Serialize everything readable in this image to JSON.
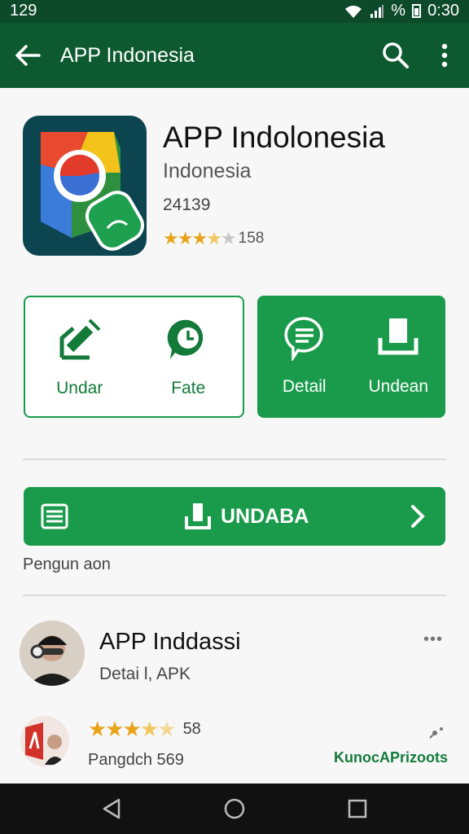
{
  "status_bar": {
    "time_left": "129",
    "battery_text": "%",
    "time_right": "0:30"
  },
  "app_bar": {
    "title": "APP Indonesia",
    "back_icon": "arrow-left-icon",
    "search_icon": "search-icon",
    "menu_icon": "more-vert-icon"
  },
  "app": {
    "name": "APP Indolonesia",
    "publisher": "Indonesia",
    "downloads": "24139",
    "rating_count": "158",
    "rating_stars": 3.5,
    "icon": "magnifier-app-icon"
  },
  "actions": [
    {
      "label": "Undar",
      "icon": "edit-home-icon"
    },
    {
      "label": "Fate",
      "icon": "clock-bubble-icon"
    },
    {
      "label": "Detail",
      "icon": "message-bubble-icon"
    },
    {
      "label": "Undean",
      "icon": "download-tray-icon"
    }
  ],
  "install": {
    "label": "UNDABA",
    "list_icon": "list-icon",
    "download_icon": "download-icon",
    "chevron_icon": "chevron-right-icon",
    "caption": "Pengun aon"
  },
  "related": [
    {
      "name": "APP Inddassi",
      "subtitle": "Detai l, APK",
      "menu": "•••"
    },
    {
      "rating_text": "58",
      "rating_stars": 3.5,
      "subtitle": "Pangdch 569",
      "link": "KunocAPrizoots"
    }
  ],
  "nav_bar": {
    "back_icon": "nav-back-icon",
    "home_icon": "nav-home-icon",
    "recents_icon": "nav-recents-icon"
  },
  "colors": {
    "primary_dark": "#0e5a30",
    "primary": "#1a9b4b",
    "star": "#e8a317"
  }
}
